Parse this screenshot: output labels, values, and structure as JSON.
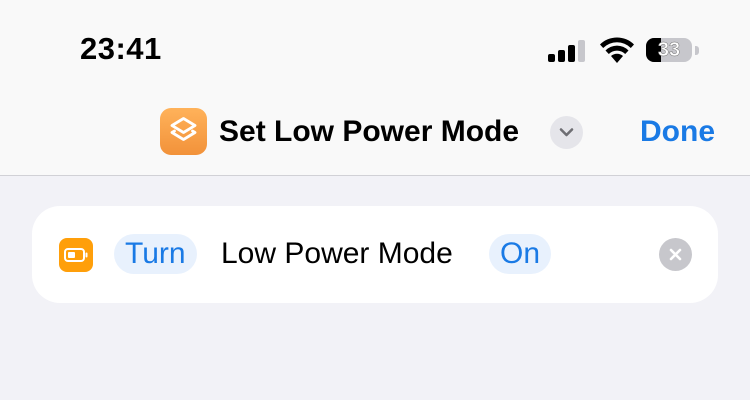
{
  "status_bar": {
    "time": "23:41",
    "signal_icon": "cellular-signal-icon",
    "wifi_icon": "wifi-icon",
    "battery_percent": "33",
    "battery_level": 0.33
  },
  "nav": {
    "shortcut_icon": "shortcuts-layers-icon",
    "title": "Set Low Power Mode",
    "title_menu_icon": "chevron-down-icon",
    "done_label": "Done"
  },
  "action": {
    "icon": "battery-icon",
    "verb": "Turn",
    "setting": "Low Power Mode",
    "state": "On",
    "clear_icon": "close-icon"
  },
  "colors": {
    "accent": "#1a7ae5",
    "shortcut_orange": "#f2923a",
    "action_orange": "#ff9f0a",
    "token_bg": "#e8f1fd",
    "page_bg": "#f2f2f7"
  }
}
